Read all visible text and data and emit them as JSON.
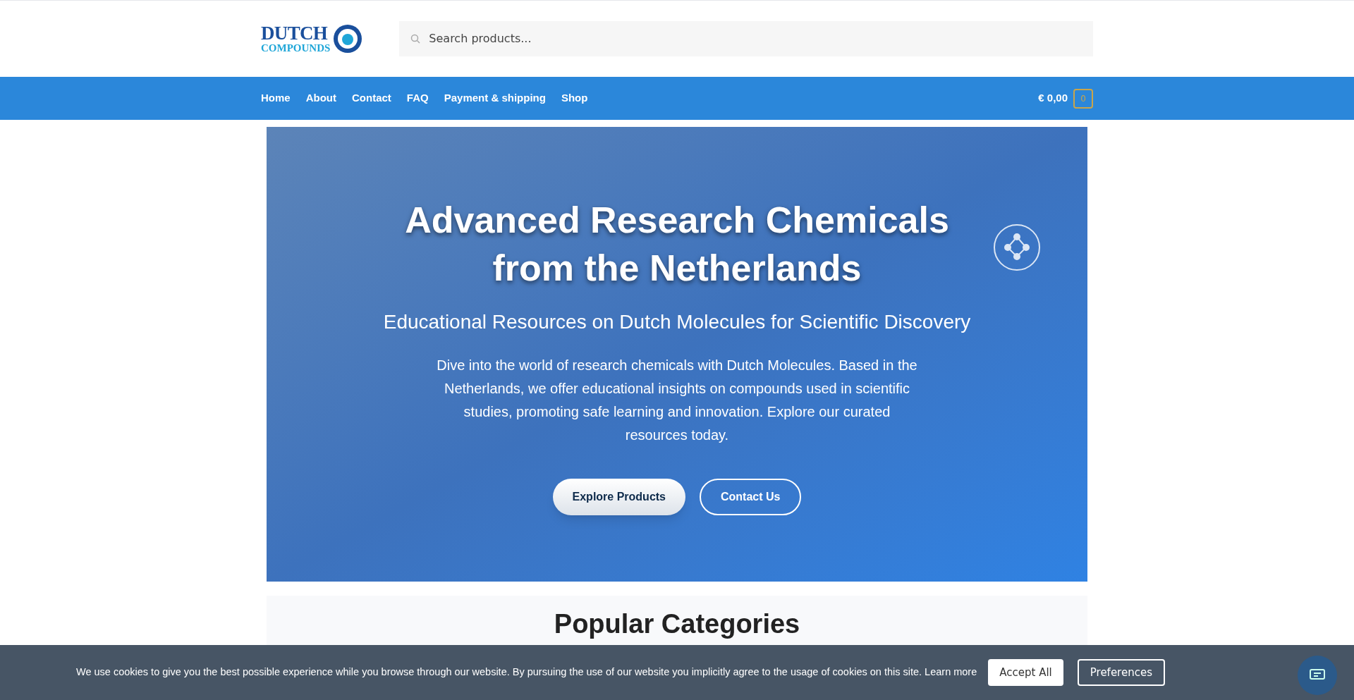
{
  "logo": {
    "line_1": "DUTCH",
    "line_2": "COMPOUNDS"
  },
  "search": {
    "placeholder": "Search products..."
  },
  "nav": {
    "items": [
      {
        "label": "Home"
      },
      {
        "label": "About"
      },
      {
        "label": "Contact"
      },
      {
        "label": "FAQ"
      },
      {
        "label": "Payment & shipping"
      },
      {
        "label": "Shop"
      }
    ],
    "cart_total": "€ 0,00",
    "cart_count": "0"
  },
  "hero": {
    "title": "Advanced Research Chemicals from the Netherlands",
    "subtitle": "Educational Resources on Dutch Molecules for Scientific Discovery",
    "body": "Dive into the world of research chemicals with Dutch Molecules. Based in the Netherlands, we offer educational insights on compounds used in scientific studies, promoting safe learning and innovation. Explore our curated resources today.",
    "buttons": [
      {
        "label": "Explore Products",
        "kind": "solid"
      },
      {
        "label": "Contact Us",
        "kind": "outline"
      }
    ]
  },
  "section": {
    "title": "Popular Categories"
  },
  "cookie_bar": {
    "text": "We use cookies to give you the best possible experience while you browse through our website. By pursuing the use of our website you implicitly agree to the usage of cookies on this site.",
    "link": "Learn more",
    "buttons": [
      {
        "label": "Accept All",
        "kind": "solid"
      },
      {
        "label": "Preferences",
        "kind": "outline"
      }
    ]
  }
}
